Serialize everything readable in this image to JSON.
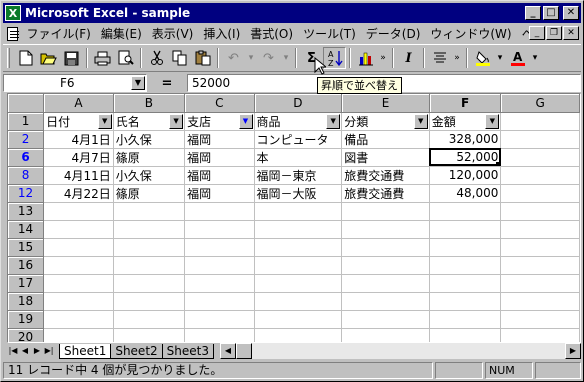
{
  "window": {
    "title": "Microsoft Excel - sample",
    "app_icon": "X"
  },
  "menu": [
    "ファイル(F)",
    "編集(E)",
    "表示(V)",
    "挿入(I)",
    "書式(O)",
    "ツール(T)",
    "データ(D)",
    "ウィンドウ(W)",
    "ヘルプ(H)"
  ],
  "formula_bar": {
    "name_box": "F6",
    "equals": "=",
    "value": "52000"
  },
  "tooltip": "昇順で並べ替え",
  "columns": [
    "A",
    "B",
    "C",
    "D",
    "E",
    "F",
    "G"
  ],
  "header_row": {
    "row": "1",
    "cells": [
      "日付",
      "氏名",
      "支店",
      "商品",
      "分類",
      "金額"
    ]
  },
  "rows": [
    {
      "row": "2",
      "cells": [
        "4月1日",
        "小久保",
        "福岡",
        "コンピュータ",
        "備品",
        "328,000"
      ]
    },
    {
      "row": "6",
      "cells": [
        "4月7日",
        "篠原",
        "福岡",
        "本",
        "図書",
        "52,000"
      ]
    },
    {
      "row": "8",
      "cells": [
        "4月11日",
        "小久保",
        "福岡",
        "福岡－東京",
        "旅費交通費",
        "120,000"
      ]
    },
    {
      "row": "12",
      "cells": [
        "4月22日",
        "篠原",
        "福岡",
        "福岡－大阪",
        "旅費交通費",
        "48,000"
      ]
    }
  ],
  "empty_rows": [
    "13",
    "14",
    "15",
    "16",
    "17",
    "18",
    "19",
    "20"
  ],
  "sheet_tabs": [
    "Sheet1",
    "Sheet2",
    "Sheet3"
  ],
  "status": {
    "message": "11 レコード中 4 個が見つかりました。",
    "num": "NUM"
  },
  "colors": {
    "title_bar": "#000080",
    "filtered_row_header": "#0000ff",
    "tooltip_bg": "#ffffe1"
  }
}
